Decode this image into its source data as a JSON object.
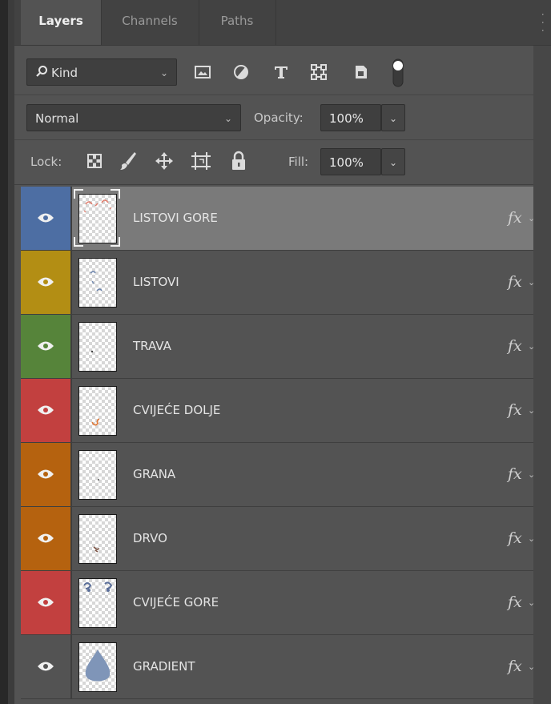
{
  "tabs": [
    {
      "label": "Layers",
      "active": true
    },
    {
      "label": "Channels",
      "active": false
    },
    {
      "label": "Paths",
      "active": false
    }
  ],
  "filter": {
    "kind_label": "Kind",
    "filter_icons": [
      "pixel-layer-filter-icon",
      "adjustment-layer-filter-icon",
      "type-layer-filter-icon",
      "shape-layer-filter-icon",
      "smart-object-filter-icon",
      "filter-toggle-icon"
    ]
  },
  "blend": {
    "mode": "Normal",
    "opacity_label": "Opacity:",
    "opacity_value": "100%"
  },
  "lock": {
    "label": "Lock:",
    "fill_label": "Fill:",
    "fill_value": "100%"
  },
  "layers": [
    {
      "name": "LISTOVI GORE",
      "color": "#4d6ea3",
      "selected": true,
      "fx": "fx"
    },
    {
      "name": "LISTOVI",
      "color": "#b38e14",
      "selected": false,
      "fx": "fx"
    },
    {
      "name": "TRAVA",
      "color": "#56843a",
      "selected": false,
      "fx": "fx"
    },
    {
      "name": "CVIJEĆE DOLJE",
      "color": "#c2403f",
      "selected": false,
      "fx": "fx"
    },
    {
      "name": "GRANA",
      "color": "#b5620f",
      "selected": false,
      "fx": "fx"
    },
    {
      "name": "DRVO",
      "color": "#b5620f",
      "selected": false,
      "fx": "fx"
    },
    {
      "name": "CVIJEĆE GORE",
      "color": "#c2403f",
      "selected": false,
      "fx": "fx"
    },
    {
      "name": "GRADIENT",
      "color": "#535353",
      "selected": false,
      "fx": "fx"
    }
  ]
}
